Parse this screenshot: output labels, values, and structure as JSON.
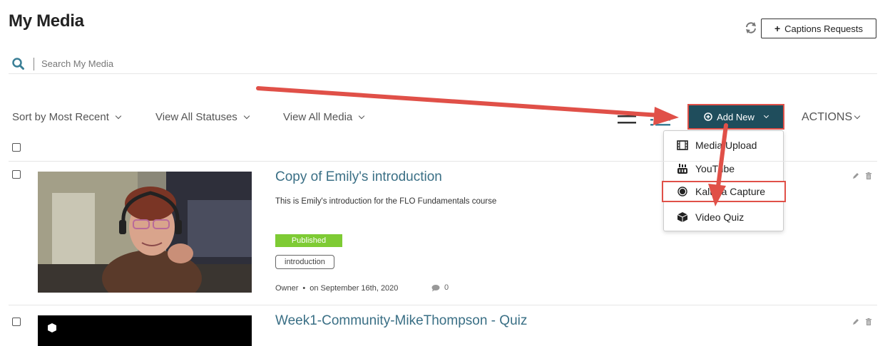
{
  "page": {
    "title": "My Media"
  },
  "header": {
    "captions_label": "Captions Requests"
  },
  "search": {
    "placeholder": "Search My Media"
  },
  "filters": {
    "sort_label": "Sort by Most Recent",
    "status_label": "View All Statuses",
    "media_label": "View All Media"
  },
  "toolbar": {
    "add_new_label": "Add New",
    "actions_label": "ACTIONS"
  },
  "add_new_menu": {
    "items": [
      {
        "label": "Media Upload",
        "icon": "film-icon"
      },
      {
        "label": "YouTube",
        "icon": "youtube-icon"
      },
      {
        "label": "Kaltura Capture",
        "icon": "record-icon"
      },
      {
        "label": "Video Quiz",
        "icon": "cube-icon"
      }
    ]
  },
  "media": {
    "items": [
      {
        "title": "Copy of Emily's introduction",
        "description": "This is Emily's introduction for the FLO Fundamentals course",
        "status": "Published",
        "tag": "introduction",
        "owner": "Owner",
        "date": "on September 16th, 2020",
        "comments": "0"
      },
      {
        "title": "Week1-Community-MikeThompson - Quiz"
      }
    ]
  },
  "colors": {
    "accent": "#1f4d5c",
    "title_link": "#3a6f85",
    "published": "#7ecb34",
    "annotation_red": "#e05048"
  }
}
